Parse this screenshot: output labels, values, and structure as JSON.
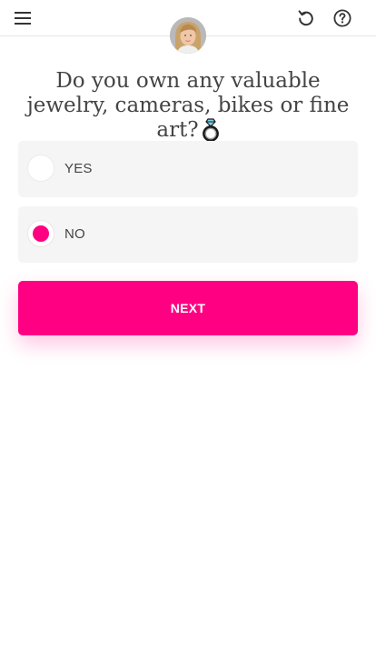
{
  "header": {
    "menu_icon": "hamburger-menu-icon",
    "undo_icon": "undo-icon",
    "help_icon": "help-circle-icon",
    "avatar": "agent-avatar"
  },
  "question": {
    "text": "Do you own any valuable jewelry, cameras, bikes or fine art?",
    "emoji_icon": "ring-emoji-icon"
  },
  "options": [
    {
      "label": "YES",
      "selected": false
    },
    {
      "label": "NO",
      "selected": true
    }
  ],
  "next_button": {
    "label": "NEXT"
  },
  "colors": {
    "accent": "#ff0083",
    "text": "#444444",
    "option_bg": "#f5f5f5"
  }
}
